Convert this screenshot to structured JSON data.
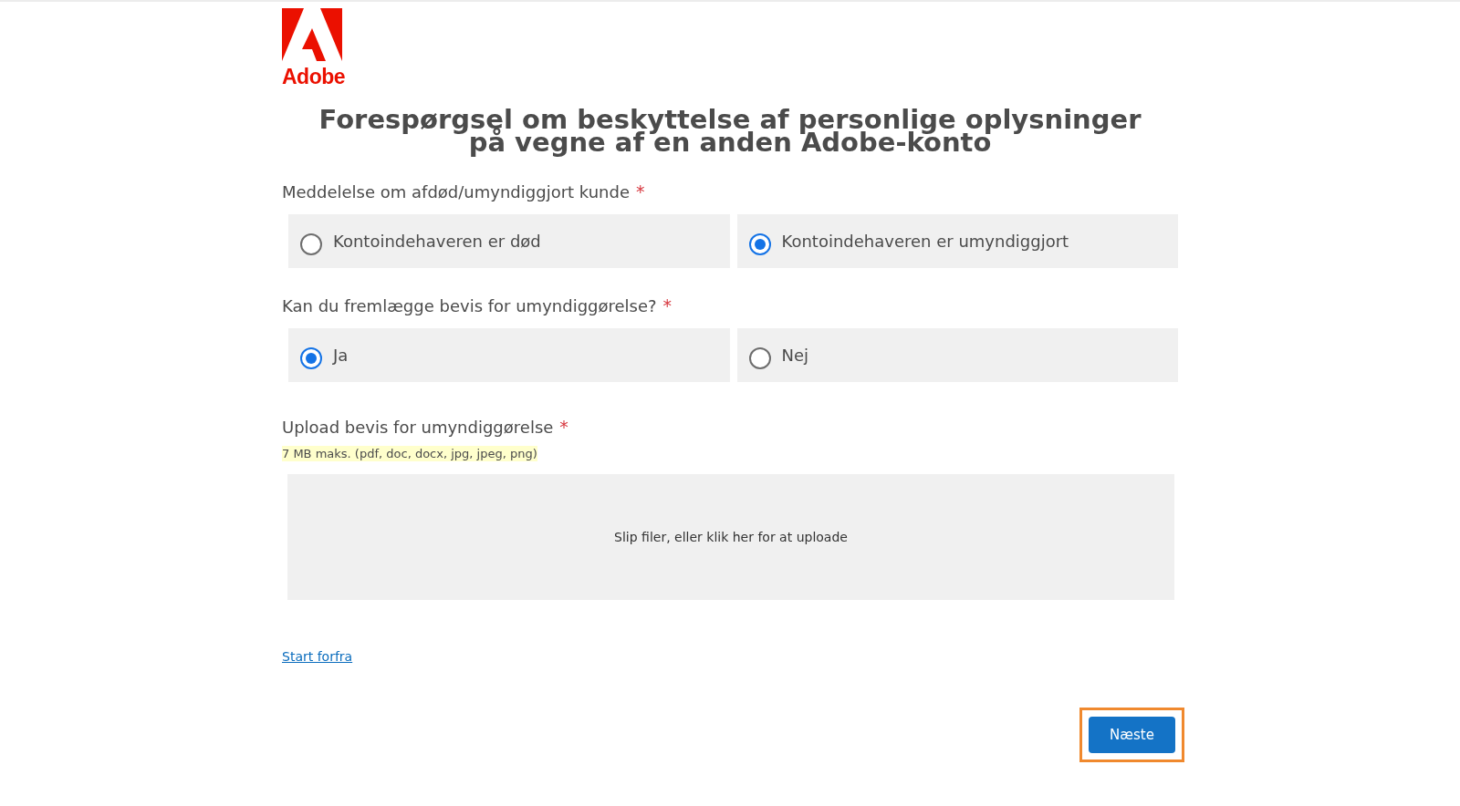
{
  "logo": {
    "wordmark": "Adobe"
  },
  "title": "Forespørgsel om beskyttelse af personlige oplysninger på vegne af en anden Adobe-konto",
  "questions": [
    {
      "label": "Meddelelse om afdød/umyndiggjort kunde",
      "required_mark": "*",
      "options": [
        {
          "label": "Kontoindehaveren er død",
          "selected": false
        },
        {
          "label": "Kontoindehaveren er umyndiggjort",
          "selected": true
        }
      ]
    },
    {
      "label": "Kan du fremlægge bevis for umyndiggørelse?",
      "required_mark": "*",
      "options": [
        {
          "label": "Ja",
          "selected": true
        },
        {
          "label": "Nej",
          "selected": false
        }
      ]
    }
  ],
  "upload": {
    "label": "Upload bevis for umyndiggørelse",
    "required_mark": "*",
    "hint": "7 MB maks. (pdf, doc, docx, jpg, jpeg, png)",
    "dropzone_text": "Slip filer, eller klik her for at uploade"
  },
  "restart_link": "Start forfra",
  "next_button": {
    "label": "Næste",
    "highlighted": true
  }
}
